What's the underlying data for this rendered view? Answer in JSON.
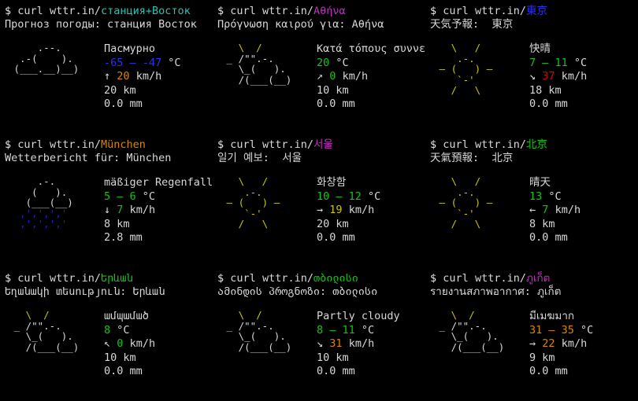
{
  "terminal": {
    "background": "#000000",
    "prompt_symbol": "$",
    "command": "curl",
    "host": "wttr.in/"
  },
  "colors": {
    "white": "#d8d8d8",
    "green": "#17c217",
    "bright_green": "#31d131",
    "yellow": "#c8c800",
    "orange": "#d78700",
    "red": "#d70000",
    "blue": "#3030e0",
    "cyan": "#2fc0b0",
    "magenta": "#c030c0"
  },
  "panels": [
    {
      "id": "vostok",
      "city_url": "станция+Восток",
      "city_url_color": "cyan",
      "headline": "Прогноз погоды: станция Восток",
      "condition": "Пасмурно",
      "condition_color": "white",
      "temperature": "-65 — -47 °C",
      "temperature_value": "-65 — -47",
      "temperature_color": "blue",
      "wind_arrow": "↑",
      "wind_speed": "20",
      "wind_unit": "km/h",
      "wind_color": "orange",
      "visibility": "20 km",
      "precipitation": "0.0 mm",
      "art_type": "overcast",
      "art_lines": [
        "     .--.   ",
        "  .-(    ). ",
        " (___.__)__)"
      ]
    },
    {
      "id": "athens",
      "city_url": "Αθήνα",
      "city_url_color": "magenta",
      "headline": "Πρόγνωση καιρού για: Αθήνα",
      "condition": "Κατά τόπους συννεφ",
      "condition_color": "white",
      "temperature": "20 °C",
      "temperature_value": "20",
      "temperature_color": "green",
      "wind_arrow": "↗",
      "wind_speed": "0",
      "wind_unit": "km/h",
      "wind_color": "green",
      "visibility": "10 km",
      "precipitation": "0.0 mm",
      "art_type": "partly-cloudy",
      "art_lines": [
        "   \\  /      ",
        " _ /\"\".-.    ",
        "   \\_(   ).  ",
        "   /(___(__) "
      ]
    },
    {
      "id": "tokyo",
      "city_url": "東京",
      "city_url_color": "blue",
      "headline": "天気予報:  東京",
      "condition": "快晴",
      "condition_color": "white",
      "temperature": "7 — 11 °C",
      "temperature_value": "7 — 11",
      "temperature_color": "green",
      "wind_arrow": "↘",
      "wind_speed": "37",
      "wind_unit": "km/h",
      "wind_color": "red",
      "visibility": "18 km",
      "precipitation": "0.0 mm",
      "art_type": "sunny",
      "art_lines": [
        "   \\   /    ",
        "    .-.     ",
        " ― (   ) ―  ",
        "    `-'     ",
        "   /   \\    "
      ]
    },
    {
      "id": "munich",
      "city_url": "München",
      "city_url_color": "orange",
      "headline": "Wetterbericht für: München",
      "condition": "mäßiger Regenfall",
      "condition_color": "white",
      "temperature": "5 — 6 °C",
      "temperature_value": "5 — 6",
      "temperature_color": "green",
      "wind_arrow": "↓",
      "wind_speed": "7",
      "wind_unit": "km/h",
      "wind_color": "green",
      "visibility": "8 km",
      "precipitation": "2.8 mm",
      "art_type": "rain",
      "art_lines": [
        "     .-.    ",
        "    (   ).  ",
        "   (___(__) "
      ],
      "art_rain_lines": [
        "  ‚'‚'‚'‚'  ",
        "  ‚'‚'‚'‚'  "
      ]
    },
    {
      "id": "seoul",
      "city_url": "서울",
      "city_url_color": "magenta",
      "headline": "일기 예보:  서울",
      "condition": "화창함",
      "condition_color": "white",
      "temperature": "10 — 12 °C",
      "temperature_value": "10 — 12",
      "temperature_color": "green",
      "wind_arrow": "→",
      "wind_speed": "19",
      "wind_unit": "km/h",
      "wind_color": "yellow",
      "visibility": "20 km",
      "precipitation": "0.0 mm",
      "art_type": "sunny",
      "art_lines": [
        "   \\   /    ",
        "    .-.     ",
        " ― (   ) ―  ",
        "    `-'     ",
        "   /   \\    "
      ]
    },
    {
      "id": "beijing",
      "city_url": "北京",
      "city_url_color": "green",
      "headline": "天氣預報:  北京",
      "condition": "晴天",
      "condition_color": "white",
      "temperature": "13 °C",
      "temperature_value": "13",
      "temperature_color": "green",
      "wind_arrow": "←",
      "wind_speed": "7",
      "wind_unit": "km/h",
      "wind_color": "green",
      "visibility": "8 km",
      "precipitation": "0.0 mm",
      "art_type": "sunny",
      "art_lines": [
        "   \\   /    ",
        "    .-.     ",
        " ― (   ) ―  ",
        "    `-'     ",
        "   /   \\    "
      ]
    },
    {
      "id": "yerevan",
      "city_url": "Երևան",
      "city_url_color": "green",
      "headline": "Եղանակի տեսություն: Երևան",
      "condition": "ամպամած",
      "condition_color": "white",
      "temperature": "8 °C",
      "temperature_value": "8",
      "temperature_color": "green",
      "wind_arrow": "↖",
      "wind_speed": "0",
      "wind_unit": "km/h",
      "wind_color": "green",
      "visibility": "10 km",
      "precipitation": "0.0 mm",
      "art_type": "partly-cloudy",
      "art_lines": [
        "   \\  /      ",
        " _ /\"\".-.    ",
        "   \\_(   ).  ",
        "   /(___(__) "
      ]
    },
    {
      "id": "tbilisi",
      "city_url": "თბილისი",
      "city_url_color": "green",
      "headline": "ამინდის პროგნოზი: თბილისი",
      "condition": "Partly cloudy",
      "condition_color": "white",
      "temperature": "8 — 11 °C",
      "temperature_value": "8 — 11",
      "temperature_color": "green",
      "wind_arrow": "↘",
      "wind_speed": "31",
      "wind_unit": "km/h",
      "wind_color": "orange",
      "visibility": "10 km",
      "precipitation": "0.0 mm",
      "art_type": "partly-cloudy",
      "art_lines": [
        "   \\  /      ",
        " _ /\"\".-.    ",
        "   \\_(   ).  ",
        "   /(___(__) "
      ]
    },
    {
      "id": "phuket",
      "city_url": "ภูเก็ต",
      "city_url_color": "magenta",
      "headline": "รายงานสภาพอากาศ: ภูเก็ต",
      "condition": "มีเมฆมาก",
      "condition_color": "white",
      "temperature": "31 — 35 °C",
      "temperature_value": "31 — 35",
      "temperature_color": "orange",
      "wind_arrow": "→",
      "wind_speed": "22",
      "wind_unit": "km/h",
      "wind_color": "orange",
      "visibility": "9 km",
      "precipitation": "0.0 mm",
      "art_type": "partly-cloudy",
      "art_lines": [
        "   \\  /      ",
        " _ /\"\".-.    ",
        "   \\_(   ).  ",
        "   /(___(__) "
      ]
    }
  ]
}
